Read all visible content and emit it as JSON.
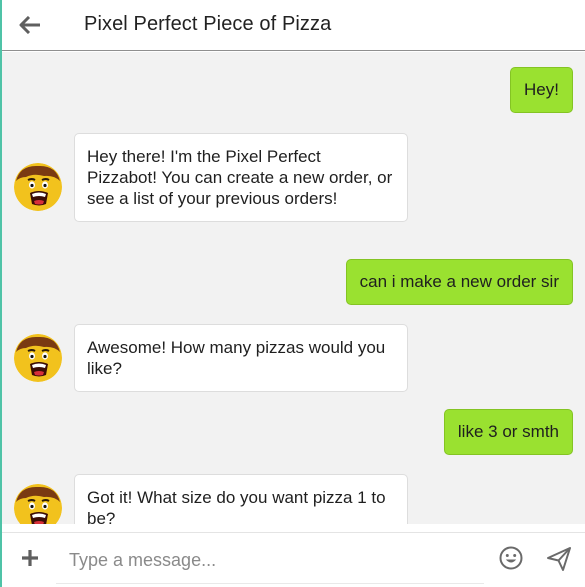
{
  "header": {
    "title": "Pixel Perfect Piece of Pizza",
    "back_icon": "back-arrow-icon"
  },
  "messages": [
    {
      "from": "user",
      "text": "Hey!"
    },
    {
      "from": "bot",
      "text": "Hey there! I'm the Pixel Perfect Pizzabot! You can create a new order, or see a list of your previous orders!"
    },
    {
      "from": "user",
      "text": "can i make a new order sir"
    },
    {
      "from": "bot",
      "text": "Awesome! How many pizzas would you like?"
    },
    {
      "from": "user",
      "text": "like 3 or smth"
    },
    {
      "from": "bot",
      "text": "Got it! What size do you want pizza 1 to be?"
    }
  ],
  "composer": {
    "placeholder": "Type a message...",
    "plus_icon": "plus-icon",
    "emoji_icon": "emoji-icon",
    "send_icon": "send-icon"
  },
  "colors": {
    "accent_border": "#4fc3a7",
    "user_bubble": "#9ae130",
    "bot_bubble": "#ffffff",
    "chat_background": "#f2f2f2"
  }
}
